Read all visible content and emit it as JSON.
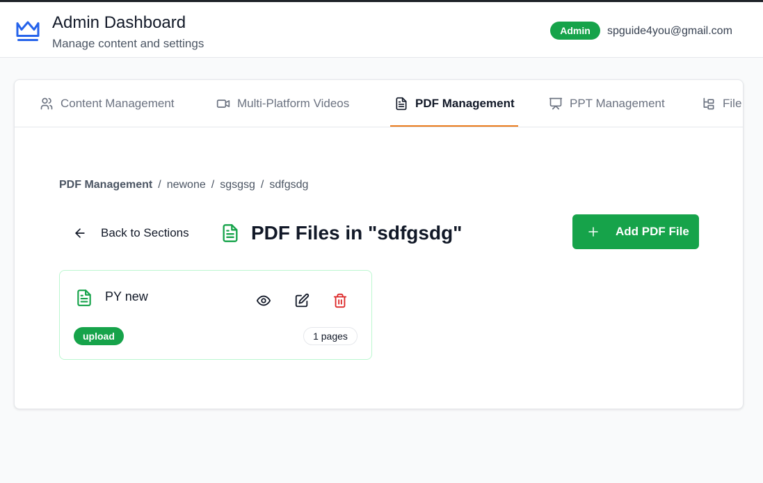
{
  "header": {
    "title": "Admin Dashboard",
    "subtitle": "Manage content and settings",
    "role_badge": "Admin",
    "user_email": "spguide4you@gmail.com",
    "logo_icon": "crown-icon"
  },
  "tabs": [
    {
      "label": "Content Management",
      "icon": "users-icon",
      "active": false
    },
    {
      "label": "Multi-Platform Videos",
      "icon": "video-icon",
      "active": false
    },
    {
      "label": "PDF Management",
      "icon": "file-text-icon",
      "active": true
    },
    {
      "label": "PPT Management",
      "icon": "presentation-icon",
      "active": false
    },
    {
      "label": "File Ma",
      "icon": "folder-tree-icon",
      "active": false
    }
  ],
  "breadcrumb": [
    "PDF Management",
    "newone",
    "sgsgsg",
    "sdfgsdg"
  ],
  "back_label": "Back to Sections",
  "section_title": "PDF Files in \"sdfgsdg\"",
  "add_button_label": "Add PDF File",
  "files": [
    {
      "name": "PY new",
      "type": "upload",
      "pages": "1 pages"
    }
  ],
  "colors": {
    "accent_green": "#16a34a",
    "tab_underline": "#ea7a1a",
    "delete_red": "#dc2626",
    "logo_blue": "#2563eb"
  }
}
